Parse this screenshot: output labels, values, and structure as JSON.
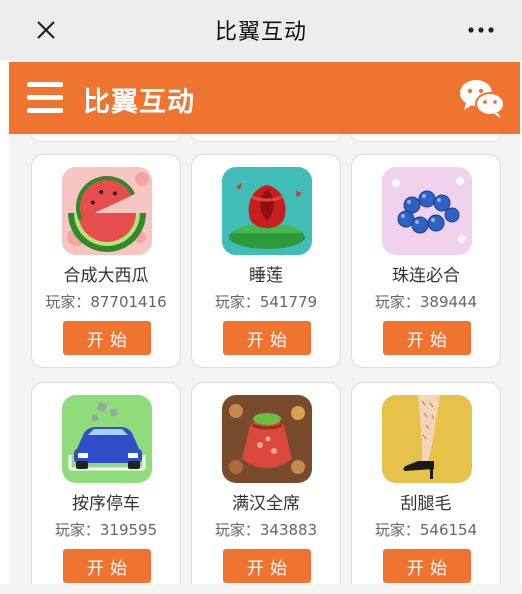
{
  "window": {
    "title": "比翼互动"
  },
  "header": {
    "title": "比翼互动",
    "accent_color": "#ef7430"
  },
  "icons": {
    "close": "close-icon",
    "more": "more-icon",
    "menu": "menu-icon",
    "wechat": "wechat-icon"
  },
  "games": [
    {
      "name": "合成大西瓜",
      "players": "玩家：87701416",
      "start_label": "开始",
      "icon": "watermelon-icon"
    },
    {
      "name": "睡莲",
      "players": "玩家：541779",
      "start_label": "开始",
      "icon": "rose-icon"
    },
    {
      "name": "珠连必合",
      "players": "玩家：389444",
      "start_label": "开始",
      "icon": "beads-icon"
    },
    {
      "name": "按序停车",
      "players": "玩家：319595",
      "start_label": "开始",
      "icon": "car-icon"
    },
    {
      "name": "满汉全席",
      "players": "玩家：343883",
      "start_label": "开始",
      "icon": "food-bag-icon"
    },
    {
      "name": "刮腿毛",
      "players": "玩家：546154",
      "start_label": "开始",
      "icon": "leg-icon"
    }
  ]
}
